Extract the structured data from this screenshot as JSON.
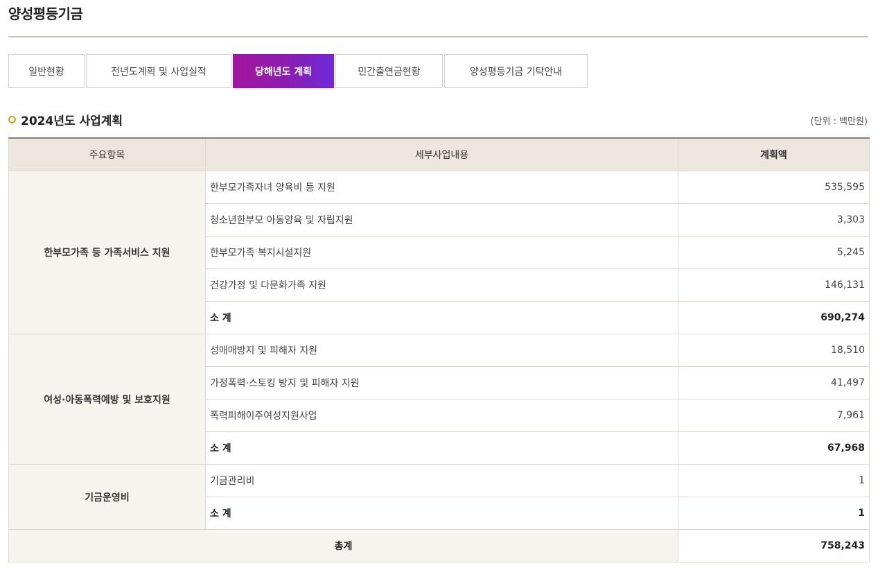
{
  "page": {
    "title": "양성평등기금"
  },
  "tabs": [
    {
      "label": "일반현황",
      "active": false
    },
    {
      "label": "전년도계획 및 사업실적",
      "active": false
    },
    {
      "label": "당해년도 계획",
      "active": true
    },
    {
      "label": "민간출연금현황",
      "active": false
    },
    {
      "label": "양성평등기금 기탁안내",
      "active": false
    }
  ],
  "section": {
    "title": "2024년도 사업계획",
    "unit_note": "(단위 : 백만원)"
  },
  "table": {
    "headers": [
      "주요항목",
      "세부사업내용",
      "계획액"
    ],
    "groups": [
      {
        "category": "한부모가족 등 가족서비스 지원",
        "rows": [
          {
            "detail": "한부모가족자녀 양육비 등 지원",
            "amount": "535,595"
          },
          {
            "detail": "청소년한부모 아동양육 및 자립지원",
            "amount": "3,303"
          },
          {
            "detail": "한부모가족 복지시설지원",
            "amount": "5,245"
          },
          {
            "detail": "건강가정 및 다문화가족 지원",
            "amount": "146,131"
          }
        ],
        "subtotal": {
          "label": "소 계",
          "amount": "690,274"
        }
      },
      {
        "category": "여성·아동폭력예방 및 보호지원",
        "rows": [
          {
            "detail": "성매매방지 및 피해자 지원",
            "amount": "18,510"
          },
          {
            "detail": "가정폭력·스토킹 방지 및 피해자 지원",
            "amount": "41,497"
          },
          {
            "detail": "폭력피해이주여성지원사업",
            "amount": "7,961"
          }
        ],
        "subtotal": {
          "label": "소 계",
          "amount": "67,968"
        }
      },
      {
        "category": "기금운영비",
        "rows": [
          {
            "detail": "기금관리비",
            "amount": "1"
          }
        ],
        "subtotal": {
          "label": "소 계",
          "amount": "1"
        }
      }
    ],
    "total": {
      "label": "총계",
      "amount": "758,243"
    }
  },
  "colors": {
    "accent_start": "#a3169e",
    "accent_end": "#6d2ad8",
    "header_bg": "#ede6de",
    "category_bg": "#f7f3ee",
    "bullet": "#d4a017"
  }
}
